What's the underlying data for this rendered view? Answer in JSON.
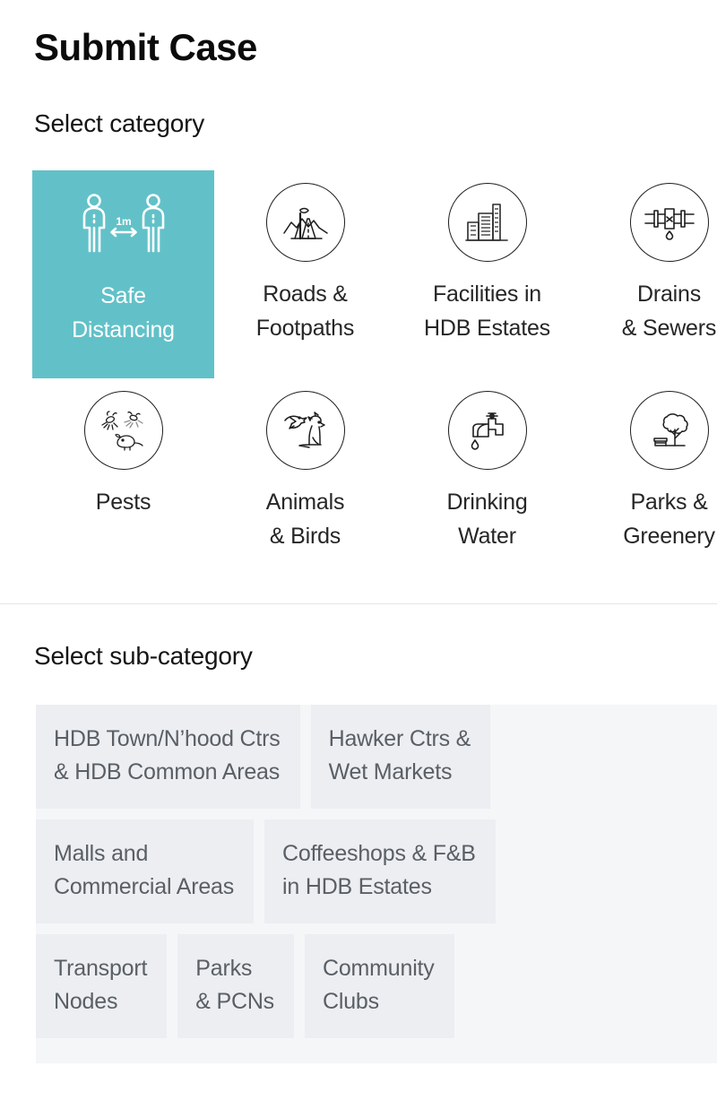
{
  "header": {
    "title": "Submit Case"
  },
  "category_section": {
    "title": "Select category",
    "selected_index": 0,
    "selected_color": "#62c1c8",
    "items": [
      {
        "label_line1": "Safe",
        "label_line2": "Distancing",
        "icon": "safe-distancing-icon",
        "selected": true
      },
      {
        "label_line1": "Roads &",
        "label_line2": "Footpaths",
        "icon": "roads-footpaths-icon",
        "selected": false
      },
      {
        "label_line1": "Facilities in",
        "label_line2": "HDB Estates",
        "icon": "hdb-facilities-icon",
        "selected": false
      },
      {
        "label_line1": "Drains",
        "label_line2": "& Sewers",
        "icon": "drains-sewer-icon",
        "selected": false
      },
      {
        "label_line1": "Pests",
        "label_line2": "",
        "icon": "pests-icon",
        "selected": false
      },
      {
        "label_line1": "Animals",
        "label_line2": "& Birds",
        "icon": "animals-birds-icon",
        "selected": false
      },
      {
        "label_line1": "Drinking",
        "label_line2": "Water",
        "icon": "drinking-water-icon",
        "selected": false
      },
      {
        "label_line1": "Parks &",
        "label_line2": "Greenery",
        "icon": "parks-greenery-icon",
        "selected": false
      }
    ]
  },
  "subcategory_section": {
    "title": "Select sub-category",
    "panel_color": "#f5f6f8",
    "chip_color": "#eceef1",
    "rows": [
      [
        {
          "label": "HDB Town/N’hood Ctrs\n& HDB Common Areas"
        },
        {
          "label": "Hawker Ctrs &\nWet Markets"
        }
      ],
      [
        {
          "label": "Malls and\nCommercial Areas"
        },
        {
          "label": "Coffeeshops & F&B\nin HDB Estates"
        }
      ],
      [
        {
          "label": "Transport\nNodes"
        },
        {
          "label": "Parks\n& PCNs"
        },
        {
          "label": "Community\nClubs"
        }
      ]
    ]
  }
}
